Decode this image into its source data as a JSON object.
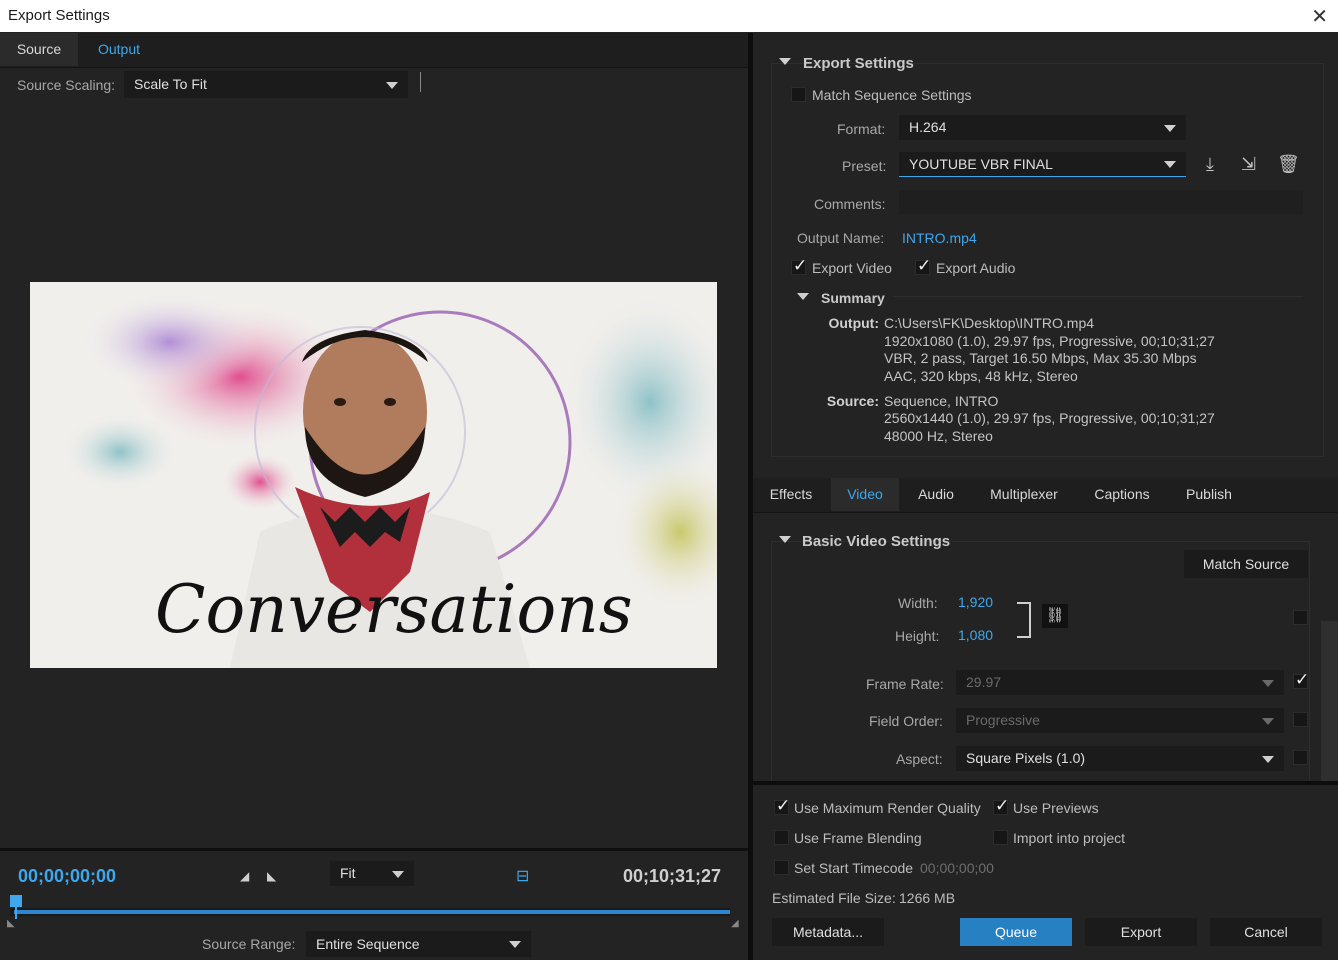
{
  "window": {
    "title": "Export Settings",
    "close_icon": "close-icon"
  },
  "left_tabs": [
    {
      "label": "Source"
    },
    {
      "label": "Output"
    }
  ],
  "source_scaling": {
    "label": "Source Scaling:",
    "value": "Scale To Fit"
  },
  "preview": {
    "overlay_text": "Conversations"
  },
  "timeline": {
    "current_tc": "00;00;00;00",
    "end_tc": "00;10;31;27",
    "zoom": "Fit",
    "source_range_label": "Source Range:",
    "source_range_value": "Entire Sequence",
    "playhead_fraction": 0.0
  },
  "export_settings": {
    "header": "Export Settings",
    "match_sequence": "Match Sequence Settings",
    "format_label": "Format:",
    "format_value": "H.264",
    "preset_label": "Preset:",
    "preset_value": "YOUTUBE VBR FINAL",
    "comments_label": "Comments:",
    "output_name_label": "Output Name:",
    "output_name_value": "INTRO.mp4",
    "export_video": "Export Video",
    "export_audio": "Export Audio"
  },
  "summary": {
    "header": "Summary",
    "output_label": "Output:",
    "output_lines": [
      "C:\\Users\\FK\\Desktop\\INTRO.mp4",
      "1920x1080 (1.0), 29.97 fps, Progressive, 00;10;31;27",
      "VBR, 2 pass, Target 16.50 Mbps, Max 35.30 Mbps",
      "AAC, 320 kbps, 48 kHz, Stereo"
    ],
    "source_label": "Source:",
    "source_lines": [
      "Sequence, INTRO",
      "2560x1440 (1.0), 29.97 fps, Progressive, 00;10;31;27",
      "48000 Hz, Stereo"
    ]
  },
  "right_tabs": [
    {
      "label": "Effects"
    },
    {
      "label": "Video"
    },
    {
      "label": "Audio"
    },
    {
      "label": "Multiplexer"
    },
    {
      "label": "Captions"
    },
    {
      "label": "Publish"
    }
  ],
  "video": {
    "header": "Basic Video Settings",
    "match_source": "Match Source",
    "width_label": "Width:",
    "width_value": "1,920",
    "height_label": "Height:",
    "height_value": "1,080",
    "frame_rate_label": "Frame Rate:",
    "frame_rate_value": "29.97",
    "field_order_label": "Field Order:",
    "field_order_value": "Progressive",
    "aspect_label": "Aspect:",
    "aspect_value": "Square Pixels (1.0)"
  },
  "bottom": {
    "max_render": "Use Maximum Render Quality",
    "use_previews": "Use Previews",
    "frame_blending": "Use Frame Blending",
    "import_project": "Import into project",
    "set_start_tc": "Set Start Timecode",
    "start_tc_value": "00;00;00;00",
    "est_size_label": "Estimated File Size:",
    "est_size_value": "1266 MB",
    "metadata": "Metadata...",
    "queue": "Queue",
    "export": "Export",
    "cancel": "Cancel"
  },
  "colors": {
    "accent": "#3ea7ee",
    "primary_button": "#2680c2",
    "background": "#232323"
  }
}
